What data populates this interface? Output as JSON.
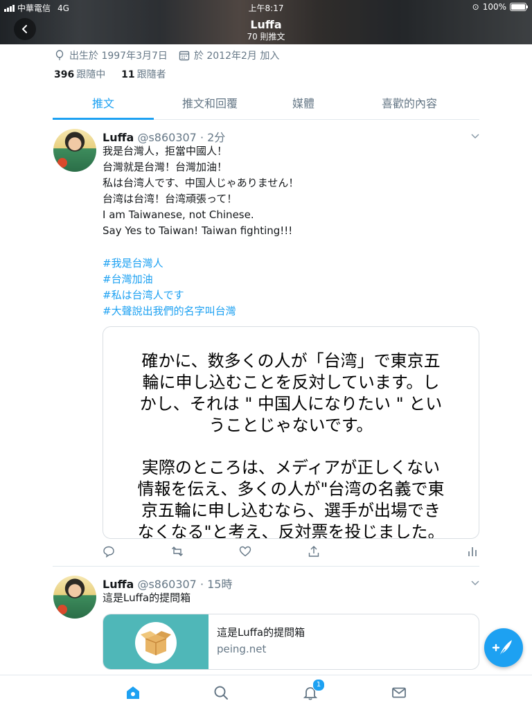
{
  "status_bar": {
    "carrier": "中華電信",
    "network": "4G",
    "time": "上午8:17",
    "battery": "100%"
  },
  "header": {
    "title": "Luffa",
    "subtitle": "70 則推文"
  },
  "profile": {
    "birth": "出生於 1997年3月7日",
    "joined": "於 2012年2月 加入",
    "following_count": "396",
    "following_label": "跟隨中",
    "followers_count": "11",
    "followers_label": "跟隨者"
  },
  "tabs": [
    {
      "label": "推文",
      "active": true
    },
    {
      "label": "推文和回覆"
    },
    {
      "label": "媒體"
    },
    {
      "label": "喜歡的內容"
    }
  ],
  "tweets": [
    {
      "name": "Luffa",
      "handle": "@s860307 · 2分",
      "text": "我是台灣人，拒當中國人！\n台灣就是台灣！台灣加油！\n私は台湾人です、中国人じゃありません！\n台湾は台湾！台湾頑張って！\nI am Taiwanese, not Chinese.\nSay Yes to Taiwan! Taiwan fighting!!!",
      "hashtags": [
        "#我是台灣人",
        "#台灣加油",
        "#私は台湾人です",
        "#大聲說出我們的名字叫台灣"
      ],
      "image_text": [
        "確かに、数多くの人が「台湾」で東京五\n輪に申し込むことを反対しています。し\nかし、それは \" 中国人になりたい \" とい\nうことじゃないです。",
        "実際のところは、メディアが正しくない\n情報を伝え、多くの人が\"台湾の名義で東\n京五輪に申し込むなら、選手が出場でき\nなくなる\"と考え、反対票を投じました。"
      ]
    },
    {
      "name": "Luffa",
      "handle": "@s860307 · 15時",
      "text": "這是Luffa的提問箱",
      "link_title": "這是Luffa的提問箱",
      "link_domain": "peing.net"
    }
  ],
  "nav": {
    "notification_badge": "1"
  },
  "colors": {
    "accent": "#1da1f2",
    "muted": "#657786"
  }
}
